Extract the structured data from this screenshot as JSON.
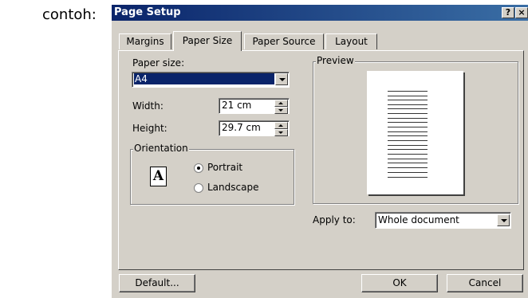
{
  "caption": "contoh:",
  "dialog": {
    "title": "Page Setup",
    "help_button": "?",
    "close_button": "×"
  },
  "tabs": [
    {
      "label": "Margins",
      "active": false
    },
    {
      "label": "Paper Size",
      "active": true
    },
    {
      "label": "Paper Source",
      "active": false
    },
    {
      "label": "Layout",
      "active": false
    }
  ],
  "paper_size": {
    "label": "Paper size:",
    "value": "A4"
  },
  "width": {
    "label": "Width:",
    "value": "21 cm"
  },
  "height": {
    "label": "Height:",
    "value": "29.7 cm"
  },
  "orientation": {
    "label": "Orientation",
    "icon_letter": "A",
    "options": [
      {
        "label": "Portrait",
        "selected": true
      },
      {
        "label": "Landscape",
        "selected": false
      }
    ]
  },
  "preview": {
    "label": "Preview"
  },
  "apply_to": {
    "label": "Apply to:",
    "value": "Whole document"
  },
  "buttons": {
    "default": "Default...",
    "ok": "OK",
    "cancel": "Cancel"
  }
}
